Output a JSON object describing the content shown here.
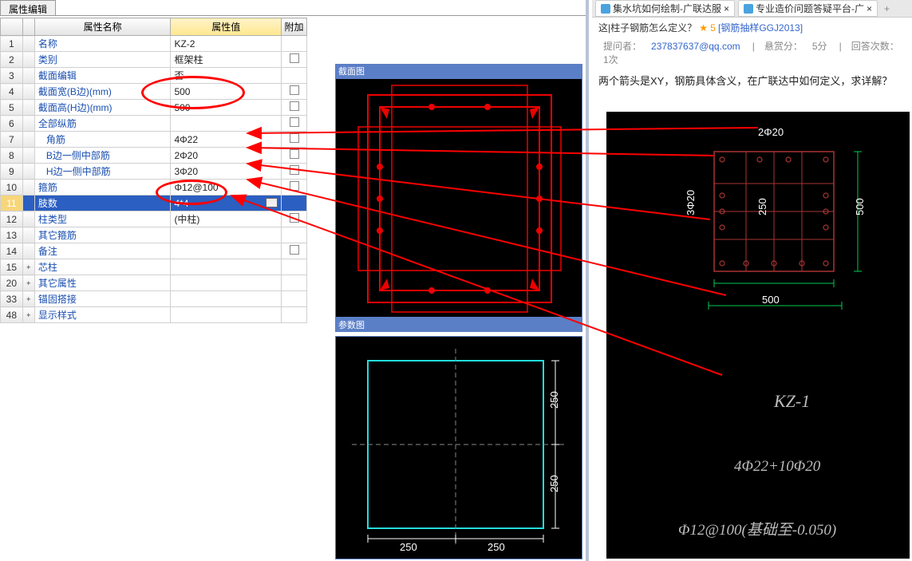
{
  "tab": {
    "label": "属性编辑"
  },
  "headers": {
    "name": "属性名称",
    "value": "属性值",
    "extra": "附加"
  },
  "rows": [
    {
      "n": "1",
      "name": "名称",
      "val": "KZ-2",
      "chk": false,
      "exp": ""
    },
    {
      "n": "2",
      "name": "类别",
      "val": "框架柱",
      "chk": true,
      "exp": ""
    },
    {
      "n": "3",
      "name": "截面编辑",
      "val": "否",
      "chk": false,
      "exp": ""
    },
    {
      "n": "4",
      "name": "截面宽(B边)(mm)",
      "val": "500",
      "chk": true,
      "exp": ""
    },
    {
      "n": "5",
      "name": "截面高(H边)(mm)",
      "val": "500",
      "chk": true,
      "exp": ""
    },
    {
      "n": "6",
      "name": "全部纵筋",
      "val": "",
      "chk": true,
      "exp": ""
    },
    {
      "n": "7",
      "name": "角筋",
      "val": "4Φ22",
      "chk": true,
      "exp": "",
      "indent": true
    },
    {
      "n": "8",
      "name": "B边一侧中部筋",
      "val": "2Φ20",
      "chk": true,
      "exp": "",
      "indent": true
    },
    {
      "n": "9",
      "name": "H边一侧中部筋",
      "val": "3Φ20",
      "chk": true,
      "exp": "",
      "indent": true
    },
    {
      "n": "10",
      "name": "箍筋",
      "val": "Φ12@100",
      "chk": true,
      "exp": ""
    },
    {
      "n": "11",
      "name": "肢数",
      "val": "4*4",
      "chk": false,
      "exp": "",
      "sel": true,
      "more": true
    },
    {
      "n": "12",
      "name": "柱类型",
      "val": "(中柱)",
      "chk": true,
      "exp": ""
    },
    {
      "n": "13",
      "name": "其它箍筋",
      "val": "",
      "chk": false,
      "exp": ""
    },
    {
      "n": "14",
      "name": "备注",
      "val": "",
      "chk": true,
      "exp": ""
    },
    {
      "n": "15",
      "name": "芯柱",
      "val": "",
      "chk": false,
      "exp": "+"
    },
    {
      "n": "20",
      "name": "其它属性",
      "val": "",
      "chk": false,
      "exp": "+"
    },
    {
      "n": "33",
      "name": "锚固搭接",
      "val": "",
      "chk": false,
      "exp": "+"
    },
    {
      "n": "48",
      "name": "显示样式",
      "val": "",
      "chk": false,
      "exp": "+"
    }
  ],
  "diagrams": {
    "d1": "截面图",
    "d2": "参数图",
    "dim250": "250",
    "dim500": "500"
  },
  "browser": {
    "tab1": "集水坑如何绘制-广联达服",
    "tab2": "专业造价问题答疑平台-广",
    "plus": "+",
    "close": "×"
  },
  "qa": {
    "crumb_prefix": "这|柱子钢筋怎么定义？",
    "link": "[钢筋抽样GGJ2013]",
    "asker_label": "提问者：",
    "asker": "237837637@qq.com",
    "bounty_label": "悬赏分：",
    "bounty": "5分",
    "count_label": "回答次数：",
    "count": "1次",
    "question": "两个箭头是XY，钢筋具体含义，在广联达中如何定义，求详解？"
  },
  "cad": {
    "top": "2Φ20",
    "left": "3Φ20",
    "inner": "250",
    "right": "500",
    "bottom": "500",
    "kz": "KZ-1",
    "line2": "4Φ22+10Φ20",
    "line3": "Φ12@100(基础至-0.050)"
  }
}
